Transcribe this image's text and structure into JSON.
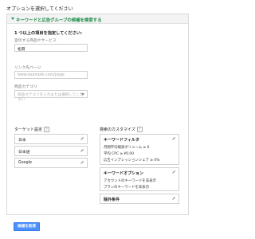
{
  "page_title": "オプションを選択してください",
  "section": {
    "title": "キーワードと広告グループの候補を検索する"
  },
  "hint": "1 つ以上の項目を指定してください:",
  "fields": {
    "product": {
      "label": "宣伝する商品やサービス",
      "value": "松茸"
    },
    "landing_page": {
      "label": "リンク先ページ",
      "placeholder": "www.example.com/page"
    },
    "category": {
      "label": "商品カテゴリ",
      "placeholder": "商品カテゴリを入力または選択してください"
    }
  },
  "targeting": {
    "title": "ターゲット設定",
    "items": [
      "日本",
      "日本語",
      "Google"
    ]
  },
  "customize": {
    "title": "検索のカスタマイズ",
    "keyword_filter": {
      "title": "キーワードフィルタ",
      "lines": [
        "月間平均検索ボリューム ≥ 0",
        "平均 CPC ≥ ¥0.00",
        "広告インプレッションシェア ≥ 0%"
      ]
    },
    "keyword_options": {
      "title": "キーワードオプション",
      "lines": [
        "アカウントのキーワードを非表示",
        "プランのキーワードを非表示"
      ]
    },
    "exclude": {
      "title": "除外条件"
    }
  },
  "button_label": "候補を取得",
  "help_symbol": "?",
  "icons": {
    "pencil": "pencil-icon",
    "help": "help-icon",
    "expand": "triangle-down-icon"
  }
}
